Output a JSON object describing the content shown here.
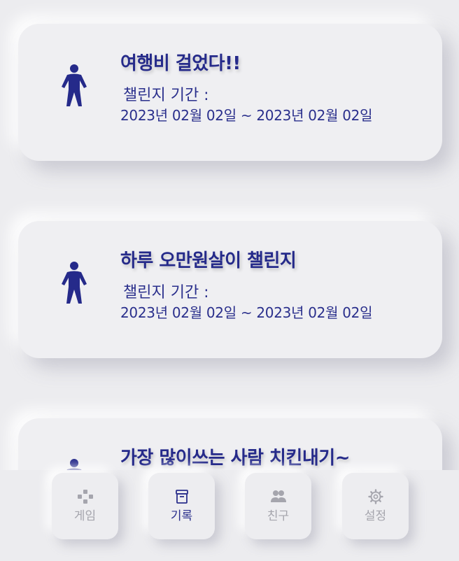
{
  "challenges": [
    {
      "title": "여행비 걸었다!!",
      "period_label": "챌린지 기간 :",
      "period_value": "2023년 02월 02일 ~ 2023년 02월 02일",
      "icon": "person-icon"
    },
    {
      "title": "하루 오만원살이 챌린지",
      "period_label": "챌린지 기간 :",
      "period_value": "2023년 02월 02일 ~ 2023년 02월 02일",
      "icon": "person-icon"
    },
    {
      "title": "가장 많이쓰는 사람 치킨내기~",
      "icon": "person-icon"
    }
  ],
  "nav": {
    "items": [
      {
        "label": "게임",
        "icon": "gamepad-icon"
      },
      {
        "label": "기록",
        "icon": "archive-box-icon",
        "active": true
      },
      {
        "label": "친구",
        "icon": "people-icon"
      },
      {
        "label": "설정",
        "icon": "gear-icon"
      }
    ]
  },
  "colors": {
    "accent": "#252a8a",
    "background": "#ececef",
    "inactive": "#a5a5ad"
  }
}
